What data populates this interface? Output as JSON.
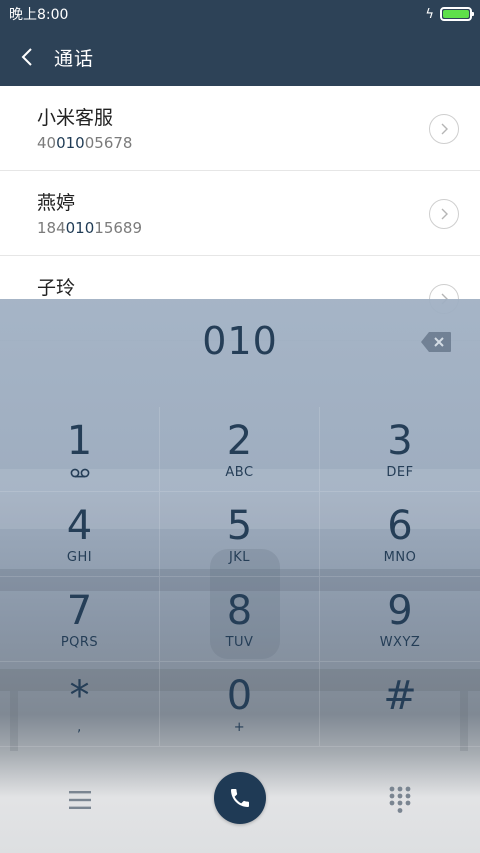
{
  "status_bar": {
    "time": "晚上8:00",
    "battery_level": 1.0
  },
  "header": {
    "title": "通话"
  },
  "contacts": [
    {
      "name": "小米客服",
      "number_prefix": "40",
      "number_match": "010",
      "number_suffix": "05678"
    },
    {
      "name": "燕婷",
      "number_prefix": "184",
      "number_match": "010",
      "number_suffix": "15689"
    },
    {
      "name": "子玲",
      "number_prefix": "",
      "number_match": "",
      "number_suffix": ""
    }
  ],
  "dialer": {
    "entered_number": "010",
    "keys": [
      {
        "digit": "1",
        "sub": ""
      },
      {
        "digit": "2",
        "sub": "ABC"
      },
      {
        "digit": "3",
        "sub": "DEF"
      },
      {
        "digit": "4",
        "sub": "GHI"
      },
      {
        "digit": "5",
        "sub": "JKL"
      },
      {
        "digit": "6",
        "sub": "MNO"
      },
      {
        "digit": "7",
        "sub": "PQRS"
      },
      {
        "digit": "8",
        "sub": "TUV"
      },
      {
        "digit": "9",
        "sub": "WXYZ"
      },
      {
        "digit": "*",
        "sub": ","
      },
      {
        "digit": "0",
        "sub": "+"
      },
      {
        "digit": "#",
        "sub": ""
      }
    ]
  },
  "colors": {
    "header_bg": "#2d4257",
    "accent": "#1f3a55",
    "battery": "#5ee04a"
  }
}
